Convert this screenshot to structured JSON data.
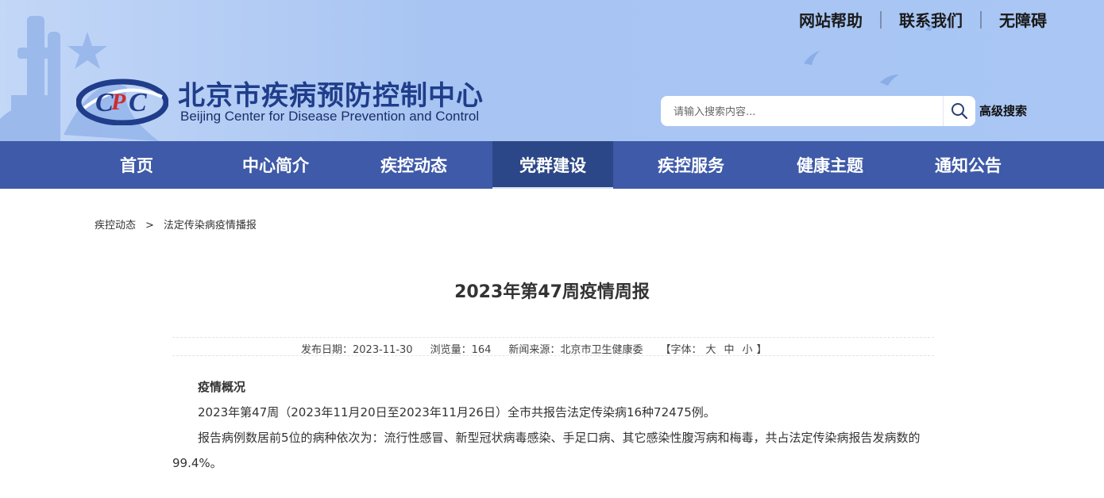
{
  "header": {
    "site_title": "北京市疾病预防控制中心",
    "site_subtitle": "Beijing Center for Disease Prevention and Control",
    "top_links": [
      "网站帮助",
      "联系我们",
      "无障碍"
    ],
    "search_placeholder": "请输入搜索内容...",
    "advanced_search": "高级搜索",
    "colors": {
      "header_bg": "#a7c4f2",
      "title": "#1f3d8a",
      "nav_bg": "#3e5aa8",
      "nav_active": "#2c4787"
    }
  },
  "nav": {
    "items": [
      "首页",
      "中心简介",
      "疾控动态",
      "党群建设",
      "疾控服务",
      "健康主题",
      "通知公告"
    ],
    "active": "党群建设"
  },
  "breadcrumb": {
    "level1": "疾控动态",
    "separator": ">",
    "level2": "法定传染病疫情播报"
  },
  "article": {
    "title": "2023年第47周疫情周报",
    "meta": {
      "date_label": "发布日期：",
      "date": "2023-11-30",
      "views_label": "浏览量：",
      "views": "164",
      "source_label": "新闻来源：",
      "source": "北京市卫生健康委",
      "font_open": "【字体：",
      "font_large": "大",
      "font_medium": "中",
      "font_small": "小",
      "font_close": "】"
    },
    "section_heading": "疫情概况",
    "paragraph1": "2023年第47周（2023年11月20日至2023年11月26日）全市共报告法定传染病16种72475例。",
    "paragraph2": "报告病例数居前5位的病种依次为：流行性感冒、新型冠状病毒感染、手足口病、其它感染性腹泻病和梅毒，共占法定传染病报告发病数的99.4%。"
  }
}
